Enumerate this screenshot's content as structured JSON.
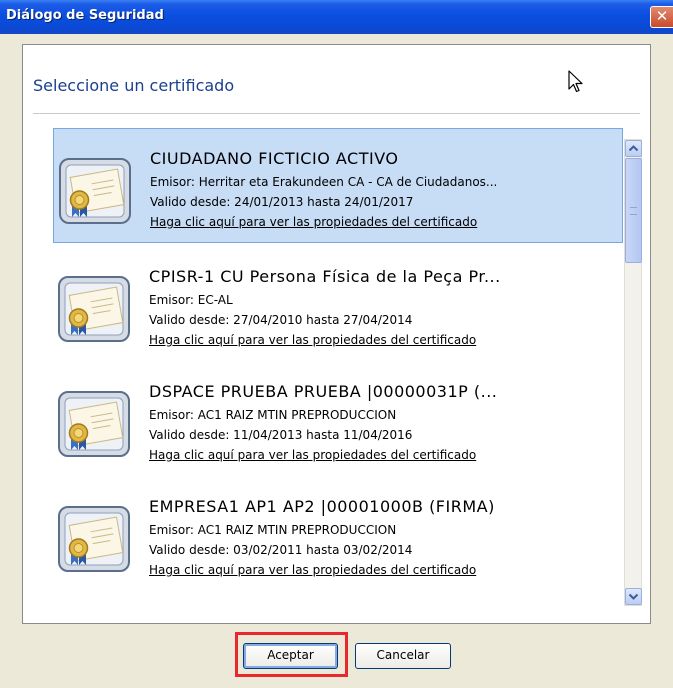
{
  "window": {
    "title": "Diálogo de Seguridad",
    "close_glyph": "✕"
  },
  "panel": {
    "heading": "Seleccione un certificado"
  },
  "certificates": [
    {
      "name": "CIUDADANO FICTICIO ACTIVO",
      "issuer": "Emisor: Herritar eta Erakundeen CA - CA de Ciudadanos...",
      "validity": "Valido desde: 24/01/2013 hasta 24/01/2017",
      "link": "Haga clic aquí para ver las propiedades del certificado",
      "selected": true
    },
    {
      "name": "CPISR-1 CU Persona Física de la Peça Pr...",
      "issuer": "Emisor: EC-AL",
      "validity": "Valido desde: 27/04/2010 hasta 27/04/2014",
      "link": "Haga clic aquí para ver las propiedades del certificado",
      "selected": false
    },
    {
      "name": "DSPACE PRUEBA PRUEBA |00000031P (...",
      "issuer": "Emisor: AC1 RAIZ MTIN PREPRODUCCION",
      "validity": "Valido desde: 11/04/2013 hasta 11/04/2016",
      "link": "Haga clic aquí para ver las propiedades del certificado",
      "selected": false
    },
    {
      "name": "EMPRESA1 AP1 AP2 |00001000B (FIRMA)",
      "issuer": "Emisor: AC1 RAIZ MTIN PREPRODUCCION",
      "validity": "Valido desde: 03/02/2011 hasta 03/02/2014",
      "link": "Haga clic aquí para ver las propiedades del certificado",
      "selected": false
    }
  ],
  "buttons": {
    "accept": "Aceptar",
    "cancel": "Cancelar"
  },
  "colors": {
    "titlebar": "#0a4fe0",
    "heading": "#1a3f8f",
    "selection": "#c7dcf5",
    "highlight": "#e8282c"
  },
  "icons": {
    "certificate": "certificate-icon",
    "cursor": "mouse-cursor-icon",
    "close": "close-icon"
  }
}
